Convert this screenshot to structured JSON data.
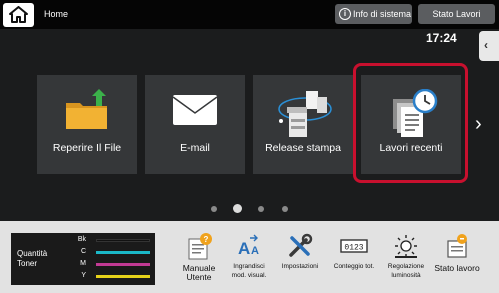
{
  "header": {
    "home_label": "Home",
    "system_info_label": "Info di sistema",
    "job_status_label": "Stato Lavori",
    "time": "17:24"
  },
  "tiles": [
    {
      "label": "Reperire Il File",
      "icon": "folder-arrow-icon"
    },
    {
      "label": "E-mail",
      "icon": "envelope-icon"
    },
    {
      "label": "Release stampa",
      "icon": "print-release-icon"
    },
    {
      "label": "Lavori recenti",
      "icon": "recent-jobs-clock-icon"
    }
  ],
  "pagination": {
    "pages": 4,
    "current": 2
  },
  "toner": {
    "title_line1": "Quantità",
    "title_line2": "Toner",
    "levels": [
      {
        "label": "Bk",
        "color": "#111111",
        "level": 1.0
      },
      {
        "label": "C",
        "color": "#1bb8c8",
        "level": 1.0
      },
      {
        "label": "M",
        "color": "#c23a94",
        "level": 1.0
      },
      {
        "label": "Y",
        "color": "#e6d21a",
        "level": 1.0
      }
    ]
  },
  "functions": [
    {
      "line1": "Manuale",
      "line2": "Utente",
      "icon": "manual-icon"
    },
    {
      "line1": "Ingrandisci",
      "line2": "mod. visual.",
      "icon": "enlarge-text-icon"
    },
    {
      "line1": "Impostazioni",
      "line2": "",
      "icon": "settings-tools-icon"
    },
    {
      "line1": "Conteggio tot.",
      "line2": "",
      "icon": "counter-icon"
    },
    {
      "line1": "Regolazione",
      "line2": "luminosità",
      "icon": "brightness-icon"
    },
    {
      "line1": "Stato lavoro",
      "line2": "",
      "icon": "job-status-icon"
    }
  ],
  "colors": {
    "accent_selection": "#c8102e",
    "tile_bg": "#353739",
    "background": "#1b1c1d"
  }
}
